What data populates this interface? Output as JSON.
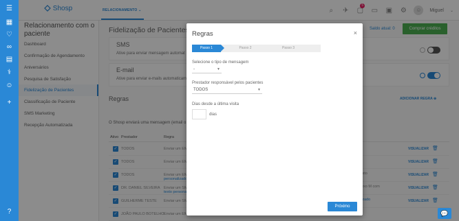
{
  "app": {
    "logo": "Shosp",
    "breadcrumb": "RELACIONAMENTO",
    "user": "Miguel",
    "notifications": "5"
  },
  "colors": {
    "primary": "#2a88d6",
    "success": "#4caf50",
    "badge": "#e91e63"
  },
  "rail_icons": [
    "menu-icon",
    "grid-icon",
    "heart-icon",
    "link-icon",
    "list-icon",
    "stethoscope-icon",
    "users-icon",
    "plus-icon",
    "help-icon"
  ],
  "topbar_icons": [
    "search-icon",
    "rocket-icon",
    "chat-bubble-icon",
    "monitor-icon",
    "calculator-icon",
    "gear-icon"
  ],
  "sidebar": {
    "title": "Relacionamento com o paciente",
    "items": [
      "Dashboard",
      "Confirmação de Agendamento",
      "Aniversários",
      "Pesquisa de Satisfação",
      "Fidelização de Pacientes",
      "Classificação de Paciente",
      "SMS Marketing",
      "Recepção Automatizada"
    ],
    "active_index": 4
  },
  "main": {
    "title": "Fidelização de Pacientes",
    "saldo": "Saldo atual: 0",
    "buy_button": "Comprar créditos",
    "sms": {
      "title": "SMS",
      "desc": "Ative para enviar mensagem automat"
    },
    "email": {
      "title": "E-mail",
      "desc": "Ative para enviar e-mails automaticam"
    },
    "regras_title": "Regras",
    "add_rule": "ADICIONAR REGRA",
    "info": "O Shosp enviará uma mensagem (email o",
    "table": {
      "headers": [
        "Ativo",
        "Prestador",
        "Regra"
      ],
      "rows": [
        {
          "prestador": "TODOS",
          "regra": "Enviar um EMA",
          "extra": "",
          "link": ""
        },
        {
          "prestador": "TODOS",
          "regra": "Enviar um EMA",
          "extra": "",
          "link": ""
        },
        {
          "prestador": "TODOS",
          "regra": "Enviar um EMA",
          "extra": "com texto",
          "link": "personalizado"
        },
        {
          "prestador": "DR. DANIEL SILVEIRA",
          "regra": "Enviar um SMS",
          "extra": "ão e sexo M com",
          "link": "texto personali"
        },
        {
          "prestador": "GUILHERME TESTE",
          "regra": "Enviar um SMS",
          "extra": "rsonalizado",
          "link": ""
        },
        {
          "prestador": "JOÃO PAULO BOTELHO",
          "regra": "Enviar um EMAIL para o paciente que não vinha entre 72 dias e que",
          "extra": "",
          "link": ""
        }
      ],
      "action": "VISUALIZAR"
    }
  },
  "modal": {
    "title": "Regras",
    "steps": [
      "Passo 1",
      "Passo 2",
      "Passo 3"
    ],
    "tipo_label": "Selecione o tipo de mensagem",
    "tipo_value": "-",
    "prestador_label": "Prestador responsável pelos pacientes",
    "prestador_value": "TODOS",
    "dias_label": "Dias desde a última visita",
    "dias_value": "",
    "dias_unit": "dias",
    "next_button": "Próximo"
  }
}
